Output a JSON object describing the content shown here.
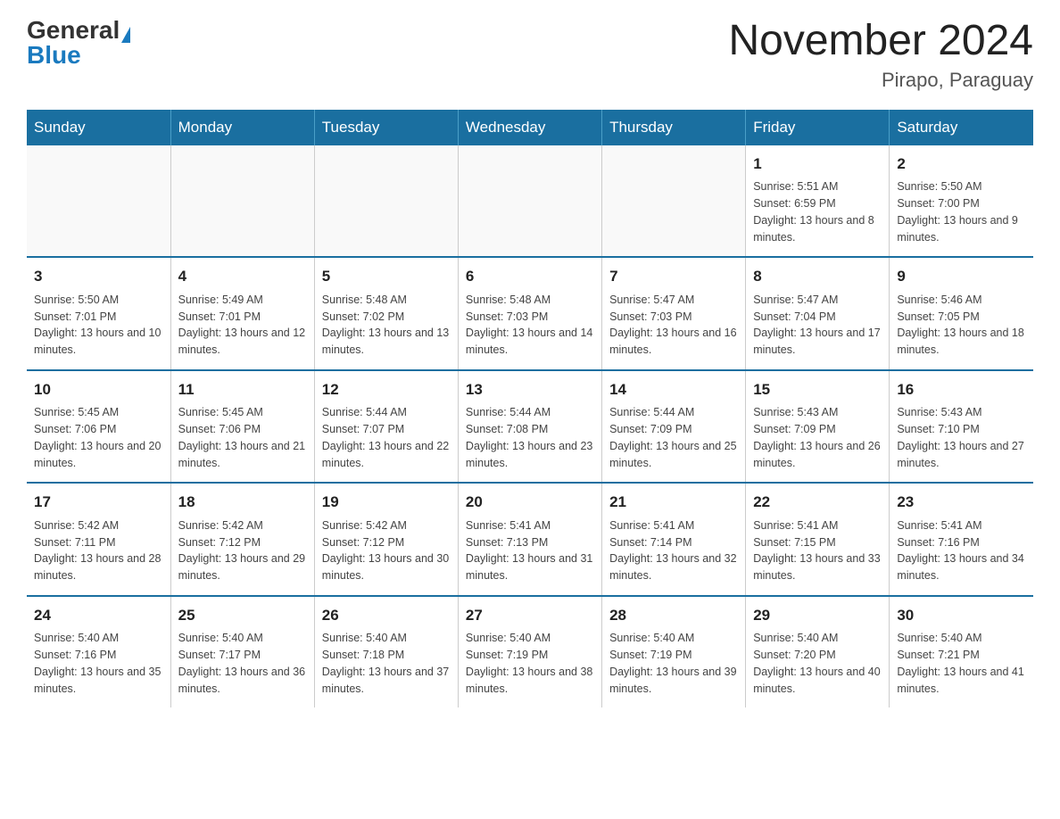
{
  "header": {
    "logo_general": "General",
    "logo_blue": "Blue",
    "calendar_title": "November 2024",
    "subtitle": "Pirapo, Paraguay"
  },
  "days_of_week": [
    "Sunday",
    "Monday",
    "Tuesday",
    "Wednesday",
    "Thursday",
    "Friday",
    "Saturday"
  ],
  "weeks": [
    [
      {
        "day": "",
        "info": ""
      },
      {
        "day": "",
        "info": ""
      },
      {
        "day": "",
        "info": ""
      },
      {
        "day": "",
        "info": ""
      },
      {
        "day": "",
        "info": ""
      },
      {
        "day": "1",
        "info": "Sunrise: 5:51 AM\nSunset: 6:59 PM\nDaylight: 13 hours and 8 minutes."
      },
      {
        "day": "2",
        "info": "Sunrise: 5:50 AM\nSunset: 7:00 PM\nDaylight: 13 hours and 9 minutes."
      }
    ],
    [
      {
        "day": "3",
        "info": "Sunrise: 5:50 AM\nSunset: 7:01 PM\nDaylight: 13 hours and 10 minutes."
      },
      {
        "day": "4",
        "info": "Sunrise: 5:49 AM\nSunset: 7:01 PM\nDaylight: 13 hours and 12 minutes."
      },
      {
        "day": "5",
        "info": "Sunrise: 5:48 AM\nSunset: 7:02 PM\nDaylight: 13 hours and 13 minutes."
      },
      {
        "day": "6",
        "info": "Sunrise: 5:48 AM\nSunset: 7:03 PM\nDaylight: 13 hours and 14 minutes."
      },
      {
        "day": "7",
        "info": "Sunrise: 5:47 AM\nSunset: 7:03 PM\nDaylight: 13 hours and 16 minutes."
      },
      {
        "day": "8",
        "info": "Sunrise: 5:47 AM\nSunset: 7:04 PM\nDaylight: 13 hours and 17 minutes."
      },
      {
        "day": "9",
        "info": "Sunrise: 5:46 AM\nSunset: 7:05 PM\nDaylight: 13 hours and 18 minutes."
      }
    ],
    [
      {
        "day": "10",
        "info": "Sunrise: 5:45 AM\nSunset: 7:06 PM\nDaylight: 13 hours and 20 minutes."
      },
      {
        "day": "11",
        "info": "Sunrise: 5:45 AM\nSunset: 7:06 PM\nDaylight: 13 hours and 21 minutes."
      },
      {
        "day": "12",
        "info": "Sunrise: 5:44 AM\nSunset: 7:07 PM\nDaylight: 13 hours and 22 minutes."
      },
      {
        "day": "13",
        "info": "Sunrise: 5:44 AM\nSunset: 7:08 PM\nDaylight: 13 hours and 23 minutes."
      },
      {
        "day": "14",
        "info": "Sunrise: 5:44 AM\nSunset: 7:09 PM\nDaylight: 13 hours and 25 minutes."
      },
      {
        "day": "15",
        "info": "Sunrise: 5:43 AM\nSunset: 7:09 PM\nDaylight: 13 hours and 26 minutes."
      },
      {
        "day": "16",
        "info": "Sunrise: 5:43 AM\nSunset: 7:10 PM\nDaylight: 13 hours and 27 minutes."
      }
    ],
    [
      {
        "day": "17",
        "info": "Sunrise: 5:42 AM\nSunset: 7:11 PM\nDaylight: 13 hours and 28 minutes."
      },
      {
        "day": "18",
        "info": "Sunrise: 5:42 AM\nSunset: 7:12 PM\nDaylight: 13 hours and 29 minutes."
      },
      {
        "day": "19",
        "info": "Sunrise: 5:42 AM\nSunset: 7:12 PM\nDaylight: 13 hours and 30 minutes."
      },
      {
        "day": "20",
        "info": "Sunrise: 5:41 AM\nSunset: 7:13 PM\nDaylight: 13 hours and 31 minutes."
      },
      {
        "day": "21",
        "info": "Sunrise: 5:41 AM\nSunset: 7:14 PM\nDaylight: 13 hours and 32 minutes."
      },
      {
        "day": "22",
        "info": "Sunrise: 5:41 AM\nSunset: 7:15 PM\nDaylight: 13 hours and 33 minutes."
      },
      {
        "day": "23",
        "info": "Sunrise: 5:41 AM\nSunset: 7:16 PM\nDaylight: 13 hours and 34 minutes."
      }
    ],
    [
      {
        "day": "24",
        "info": "Sunrise: 5:40 AM\nSunset: 7:16 PM\nDaylight: 13 hours and 35 minutes."
      },
      {
        "day": "25",
        "info": "Sunrise: 5:40 AM\nSunset: 7:17 PM\nDaylight: 13 hours and 36 minutes."
      },
      {
        "day": "26",
        "info": "Sunrise: 5:40 AM\nSunset: 7:18 PM\nDaylight: 13 hours and 37 minutes."
      },
      {
        "day": "27",
        "info": "Sunrise: 5:40 AM\nSunset: 7:19 PM\nDaylight: 13 hours and 38 minutes."
      },
      {
        "day": "28",
        "info": "Sunrise: 5:40 AM\nSunset: 7:19 PM\nDaylight: 13 hours and 39 minutes."
      },
      {
        "day": "29",
        "info": "Sunrise: 5:40 AM\nSunset: 7:20 PM\nDaylight: 13 hours and 40 minutes."
      },
      {
        "day": "30",
        "info": "Sunrise: 5:40 AM\nSunset: 7:21 PM\nDaylight: 13 hours and 41 minutes."
      }
    ]
  ]
}
